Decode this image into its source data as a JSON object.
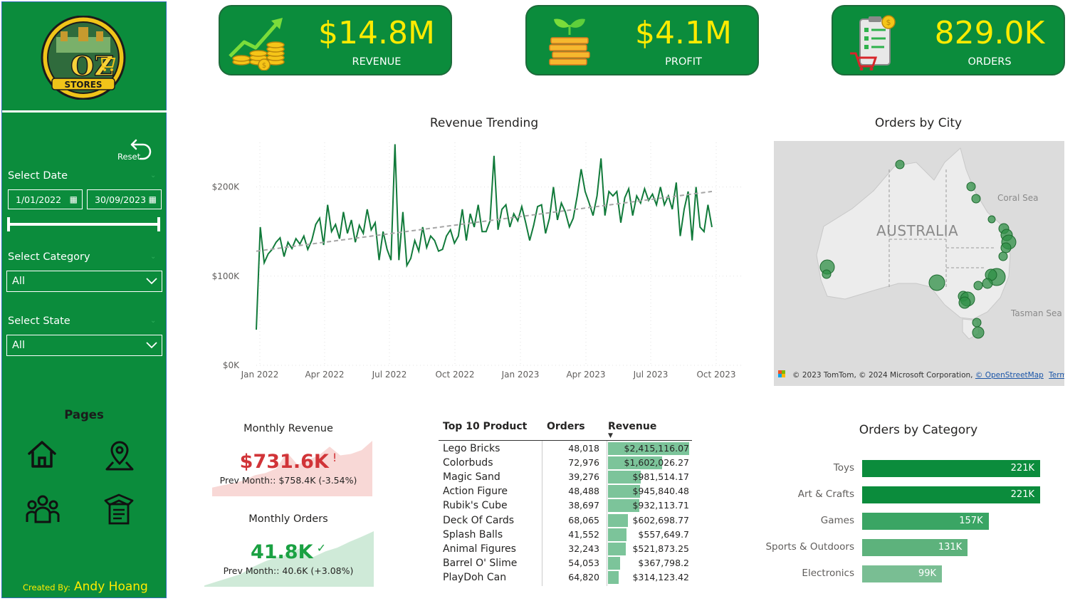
{
  "sidebar": {
    "logo_text_top": "OZ",
    "logo_text_bottom": "STORES",
    "reset_label": "Reset",
    "select_date_label": "Select Date",
    "date_start": "1/01/2022",
    "date_end": "30/09/2023",
    "select_category_label": "Select Category",
    "category_value": "All",
    "select_state_label": "Select State",
    "state_value": "All",
    "pages_label": "Pages",
    "created_by_prefix": "Created By:",
    "created_by_name": "Andy Hoang"
  },
  "kpis": [
    {
      "value": "$14.8M",
      "label": "REVENUE",
      "icon": "revenue-growth-icon"
    },
    {
      "value": "$4.1M",
      "label": "PROFIT",
      "icon": "profit-plant-icon"
    },
    {
      "value": "829.0K",
      "label": "ORDERS",
      "icon": "orders-clipboard-icon"
    }
  ],
  "revenue_trend": {
    "title": "Revenue Trending",
    "y_ticks": [
      "$0K",
      "$100K",
      "$200K"
    ],
    "x_ticks": [
      "Jan 2022",
      "Apr 2022",
      "Jul 2022",
      "Oct 2022",
      "Jan 2023",
      "Apr 2023",
      "Jul 2023",
      "Oct 2023"
    ]
  },
  "chart_data": [
    {
      "type": "line",
      "title": "Revenue Trending",
      "x_range": [
        "2022-01-01",
        "2023-10-01"
      ],
      "ylim": [
        0,
        250000
      ],
      "grid": true,
      "series": [
        {
          "values": [
            40000,
            155000,
            115000,
            125000,
            130000,
            138000,
            143000,
            122000,
            138000,
            131000,
            142000,
            136000,
            145000,
            130000,
            140000,
            158000,
            165000,
            135000,
            180000,
            150000,
            158000,
            142000,
            172000,
            148000,
            163000,
            138000,
            157000,
            148000,
            175000,
            152000,
            160000,
            118000,
            150000,
            130000,
            118000,
            248000,
            118000,
            172000,
            112000,
            120000,
            140000,
            128000,
            155000,
            132000,
            145000,
            140000,
            128000,
            130000,
            145000,
            152000,
            137000,
            145000,
            175000,
            140000,
            170000,
            155000,
            180000,
            150000,
            150000,
            162000,
            235000,
            152000,
            175000,
            180000,
            155000,
            170000,
            162000,
            178000,
            160000,
            140000,
            157000,
            178000,
            180000,
            148000,
            165000,
            200000,
            163000,
            182000,
            172000,
            155000,
            165000,
            190000,
            220000,
            195000,
            182000,
            168000,
            190000,
            232000,
            168000,
            195000,
            190000,
            195000,
            160000,
            188000,
            198000,
            168000,
            190000,
            182000,
            198000,
            185000,
            192000,
            180000,
            200000,
            180000,
            190000,
            175000,
            205000,
            145000,
            175000,
            195000,
            140000,
            200000,
            155000,
            150000,
            180000,
            155000
          ]
        },
        {
          "name": "trend",
          "style": "dashed",
          "values": [
            128000,
            195000
          ]
        }
      ]
    },
    {
      "type": "bar",
      "title": "Orders by Category",
      "orientation": "horizontal",
      "categories": [
        "Toys",
        "Art & Crafts",
        "Games",
        "Sports & Outdoors",
        "Electronics"
      ],
      "values": [
        221000,
        221000,
        157000,
        131000,
        99000
      ],
      "data_labels": [
        "221K",
        "221K",
        "157K",
        "131K",
        "99K"
      ],
      "colors": [
        "#0b8c3c",
        "#0b8c3c",
        "#3aa564",
        "#5db27c",
        "#79be93"
      ]
    },
    {
      "type": "area",
      "title": "Monthly Revenue",
      "series": [
        {
          "values": [
            30,
            38,
            45,
            55,
            72,
            80,
            95,
            150,
            108,
            125,
            140,
            170,
            140,
            145,
            158,
            190
          ]
        }
      ],
      "color": "#f8d8d6"
    },
    {
      "type": "area",
      "title": "Monthly Orders",
      "series": [
        {
          "values": [
            5,
            20,
            35,
            50,
            78,
            100,
            118,
            130,
            155,
            118,
            140,
            155,
            178,
            198,
            220
          ]
        }
      ],
      "color": "#cfead8"
    }
  ],
  "map": {
    "title": "Orders by City",
    "country_label": "AUSTRALIA",
    "sea_labels": [
      "Coral Sea",
      "Tasman Sea"
    ],
    "attribution": "© 2023 TomTom, © 2024 Microsoft Corporation,",
    "osm_link": "© OpenStreetMap",
    "terms_link": "Terms"
  },
  "monthly_revenue": {
    "title": "Monthly Revenue",
    "value": "$731.6K",
    "indicator": "!",
    "prev": "Prev Month:: $758.4K (-3.54%)",
    "value_color": "#d13438"
  },
  "monthly_orders": {
    "title": "Monthly Orders",
    "value": "41.8K",
    "indicator": "✓",
    "prev": "Prev Month:: 40.6K (+3.08%)",
    "value_color": "#1aa142"
  },
  "top_products": {
    "headers": [
      "Top 10 Product",
      "Orders",
      "Revenue"
    ],
    "max_revenue": 2415116.07,
    "rows": [
      {
        "product": "Lego Bricks",
        "orders": "48,018",
        "revenue": "$2,415,116.07",
        "rev_value": 2415116.07
      },
      {
        "product": "Colorbuds",
        "orders": "72,976",
        "revenue": "$1,602,026.27",
        "rev_value": 1602026.27
      },
      {
        "product": "Magic Sand",
        "orders": "39,276",
        "revenue": "$981,514.17",
        "rev_value": 981514.17
      },
      {
        "product": "Action Figure",
        "orders": "48,488",
        "revenue": "$945,840.48",
        "rev_value": 945840.48
      },
      {
        "product": "Rubik's Cube",
        "orders": "38,697",
        "revenue": "$932,113.71",
        "rev_value": 932113.71
      },
      {
        "product": "Deck Of Cards",
        "orders": "68,065",
        "revenue": "$602,698.77",
        "rev_value": 602698.77
      },
      {
        "product": "Splash Balls",
        "orders": "41,552",
        "revenue": "$557,649.7",
        "rev_value": 557649.7
      },
      {
        "product": "Animal Figures",
        "orders": "32,243",
        "revenue": "$521,873.25",
        "rev_value": 521873.25
      },
      {
        "product": "Barrel O' Slime",
        "orders": "54,053",
        "revenue": "$367,798.2",
        "rev_value": 367798.2
      },
      {
        "product": "PlayDoh Can",
        "orders": "64,820",
        "revenue": "$314,123.42",
        "rev_value": 314123.42
      }
    ]
  },
  "orders_by_category": {
    "title": "Orders by Category"
  },
  "colors": {
    "brand_green": "#0b8c3c",
    "kpi_yellow": "#ffeb00",
    "table_bar": "#7cc49a"
  }
}
